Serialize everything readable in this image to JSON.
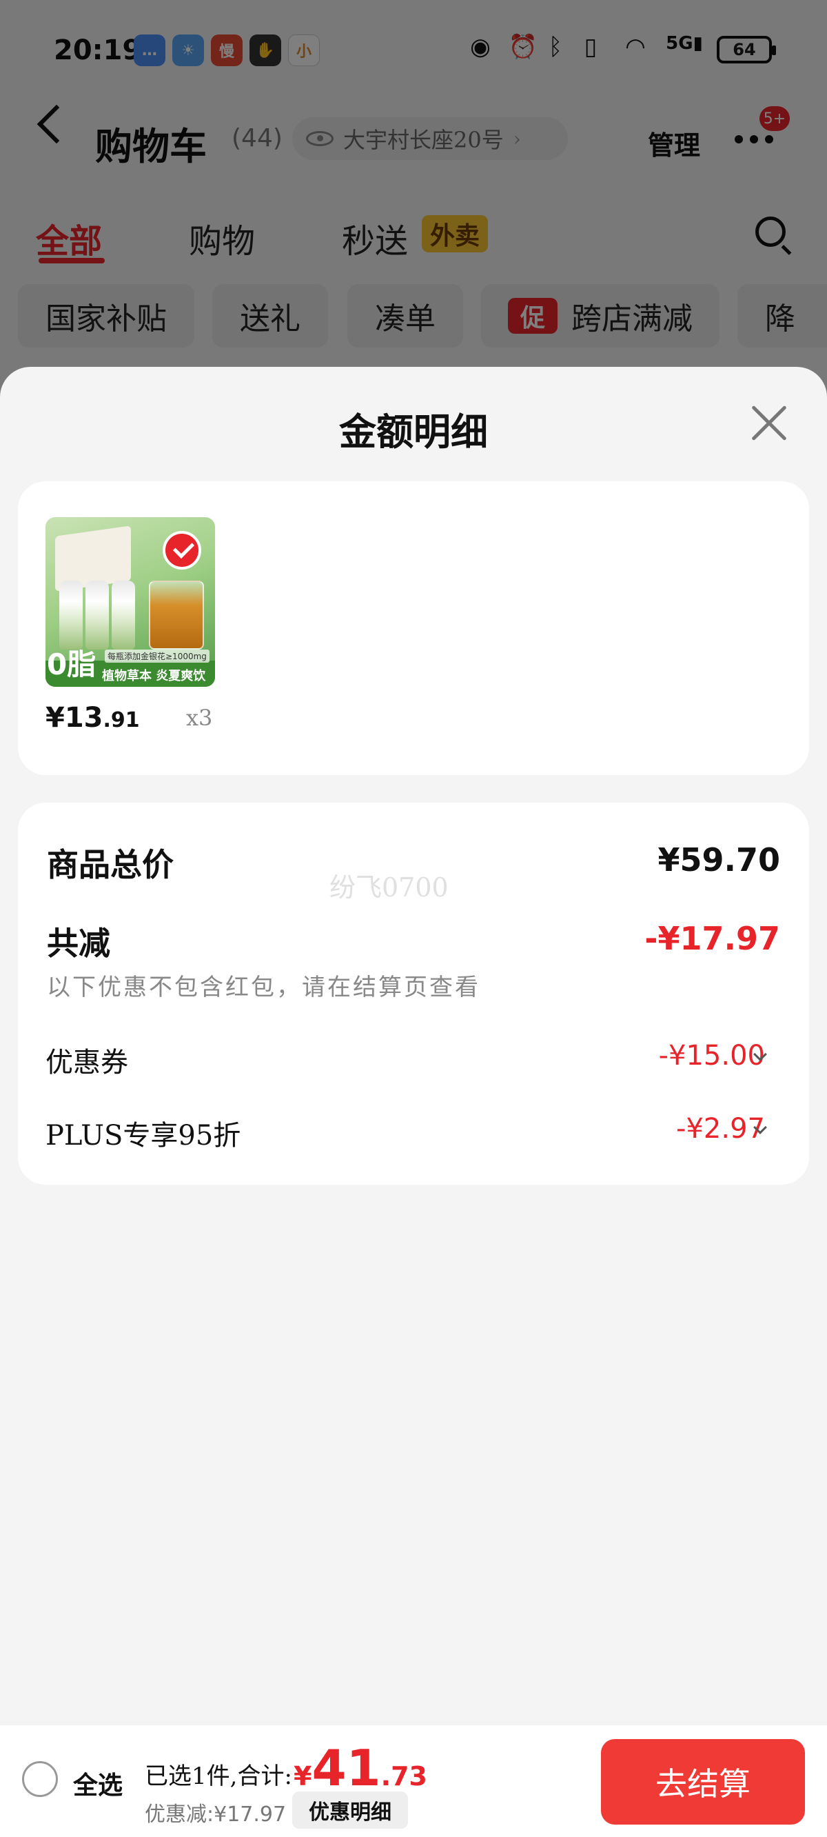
{
  "status_bar": {
    "time": "20:19",
    "app_icons": [
      {
        "name": "messages-app-icon",
        "color": "#4d8ff5",
        "glyph": "…"
      },
      {
        "name": "weather-app-icon",
        "color": "#5aa5f3",
        "glyph": "☀"
      },
      {
        "name": "slow-app-icon",
        "color": "#e84b35",
        "glyph": "慢"
      },
      {
        "name": "hand-app-icon",
        "color": "#333333",
        "glyph": "✋"
      },
      {
        "name": "xiaomi-app-icon",
        "color": "#ffffff",
        "glyph": "小"
      }
    ],
    "network": "5G",
    "battery": "64"
  },
  "header": {
    "title": "购物车",
    "count": "(44)",
    "address": "大宇村长座20号",
    "manage": "管理",
    "more_badge": "5+"
  },
  "tabs": [
    {
      "label": "全部",
      "active": true
    },
    {
      "label": "购物",
      "active": false
    },
    {
      "label": "秒送",
      "active": false,
      "badge": "外卖"
    }
  ],
  "chips": [
    {
      "label": "国家补贴"
    },
    {
      "label": "送礼"
    },
    {
      "label": "凑单"
    },
    {
      "label": "跨店满减",
      "promo": "促"
    },
    {
      "label": "降"
    }
  ],
  "sheet": {
    "title": "金额明细",
    "product": {
      "price_int": "¥13",
      "price_dec": ".91",
      "quantity": "x3",
      "thumb_badge": "0脂",
      "thumb_caption": "植物草本 炎夏爽饮",
      "thumb_note": "每瓶添加金银花≥1000mg",
      "thumb_corner": "ON"
    },
    "summary": {
      "goods_total_label": "商品总价",
      "goods_total_value": "¥59.70",
      "total_discount_label": "共减",
      "total_discount_value": "-¥17.97",
      "discount_note": "以下优惠不包含红包，请在结算页查看",
      "discounts": [
        {
          "label": "优惠券",
          "value": "-¥15.00"
        },
        {
          "label": "PLUS专享95折",
          "value": "-¥2.97"
        }
      ],
      "watermark": "纷飞0700"
    }
  },
  "checkout": {
    "select_all": "全选",
    "selected_summary": "已选1件,合计:",
    "total_symbol": "¥",
    "total_int": "41",
    "total_dec": ".73",
    "discount_text": "优惠减:¥17.97",
    "detail_button": "优惠明细",
    "checkout_button": "去结算"
  },
  "colors": {
    "accent_red": "#e8242b",
    "checkout_red": "#f03a36",
    "badge_yellow": "#f7c531"
  }
}
